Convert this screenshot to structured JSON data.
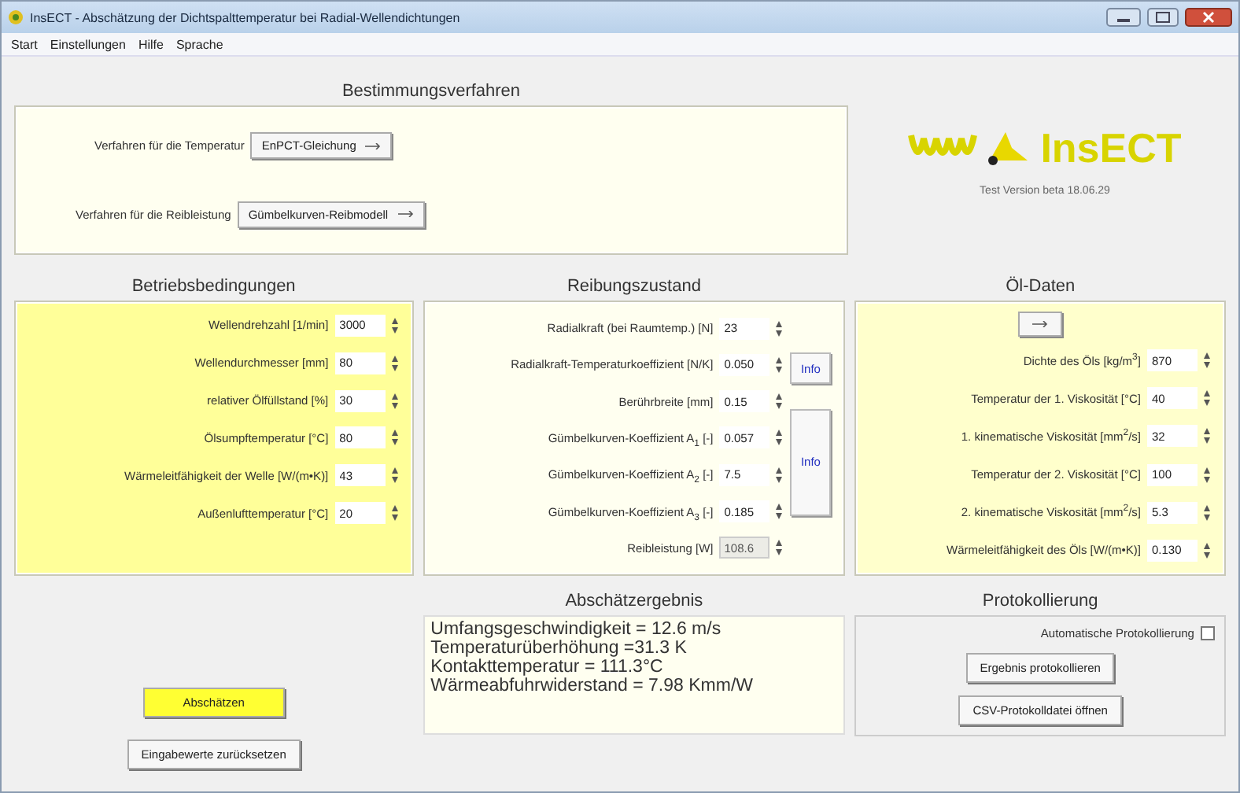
{
  "window": {
    "title": "InsECT - Abschätzung der Dichtspalttemperatur bei Radial-Wellendichtungen"
  },
  "menu": [
    "Start",
    "Einstellungen",
    "Hilfe",
    "Sprache"
  ],
  "method": {
    "title": "Bestimmungsverfahren",
    "rows": [
      {
        "label": "Verfahren für die Temperatur",
        "value": "EnPCT-Gleichung"
      },
      {
        "label": "Verfahren für die Reibleistung",
        "value": "Gümbelkurven-Reibmodell"
      }
    ]
  },
  "logo": {
    "text": "InsECT",
    "version": "Test Version beta 18.06.29"
  },
  "operating": {
    "title": "Betriebsbedingungen",
    "fields": [
      {
        "label": "Wellendrehzahl [1/min]",
        "value": "3000",
        "disabled": false
      },
      {
        "label": "Wellendurchmesser [mm]",
        "value": "80",
        "disabled": false
      },
      {
        "label": "relativer Ölfüllstand [%]",
        "value": "30",
        "disabled": false
      },
      {
        "label": "Ölsumpftemperatur [°C]",
        "value": "80",
        "disabled": false
      },
      {
        "label": "Wärmeleitfähigkeit der Welle [W/(m•K)]",
        "value": "43",
        "disabled": false
      },
      {
        "label": "Außenlufttemperatur [°C]",
        "value": "20",
        "disabled": false
      }
    ]
  },
  "friction": {
    "title": "Reibungszustand",
    "info_labels": [
      "Info",
      "Info"
    ],
    "fields": [
      {
        "label": "Radialkraft (bei Raumtemp.) [N]",
        "value": "23",
        "disabled": false
      },
      {
        "label": "Radialkraft-Temperaturkoeffizient [N/K]",
        "value": "0.050",
        "disabled": false
      },
      {
        "label": "Berührbreite [mm]",
        "value": "0.15",
        "disabled": false
      },
      {
        "label": "Gümbelkurven-Koeffizient A$_{1}$ [-]",
        "value": "0.057",
        "disabled": false
      },
      {
        "label": "Gümbelkurven-Koeffizient A$_{2}$ [-]",
        "value": "7.5",
        "disabled": false
      },
      {
        "label": "Gümbelkurven-Koeffizient A$_{3}$ [-]",
        "value": "0.185",
        "disabled": false
      },
      {
        "label": "Reibleistung [W]",
        "value": "108.6",
        "disabled": true
      }
    ]
  },
  "oil": {
    "title": "Öl-Daten",
    "fields": [
      {
        "label": "Dichte des Öls [kg/m$^{3}$]",
        "value": "870",
        "disabled": false
      },
      {
        "label": "Temperatur der 1. Viskosität [°C]",
        "value": "40",
        "disabled": false
      },
      {
        "label": "1. kinematische Viskosität [mm$^{2}$/s]",
        "value": "32",
        "disabled": false
      },
      {
        "label": "Temperatur der 2. Viskosität [°C]",
        "value": "100",
        "disabled": false
      },
      {
        "label": "2. kinematische Viskosität [mm$^{2}$/s]",
        "value": "5.3",
        "disabled": false
      },
      {
        "label": "Wärmeleitfähigkeit des Öls [W/(m•K)]",
        "value": "0.130",
        "disabled": false
      }
    ]
  },
  "actions": [
    "Abschätzen",
    "Eingabewerte zurücksetzen"
  ],
  "result": {
    "title": "Abschätzergebnis",
    "lines": [
      "Umfangsgeschwindigkeit = 12.6 m/s",
      "Temperaturüberhöhung =31.3 K",
      "Kontakttemperatur = 111.3°C",
      "Wärmeabfuhrwiderstand = 7.98 Kmm/W"
    ]
  },
  "logging": {
    "title": "Protokollierung",
    "auto_label": "Automatische Protokollierung",
    "auto_checked": false,
    "buttons": [
      "Ergebnis protokollieren",
      "CSV-Protokolldatei öffnen"
    ]
  }
}
